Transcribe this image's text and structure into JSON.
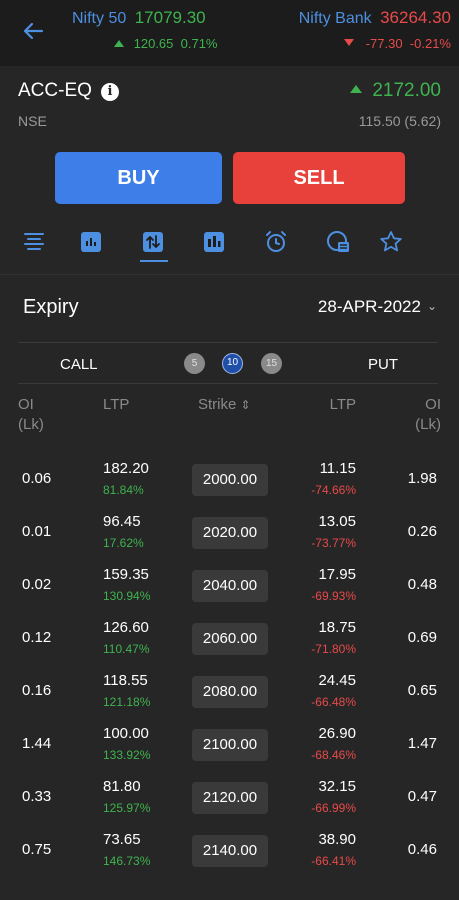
{
  "header": {
    "left_index": {
      "name": "Nifty 50",
      "value": "17079.30",
      "change": "120.65",
      "change_pct": "0.71%"
    },
    "right_index": {
      "name": "Nifty Bank",
      "value": "36264.30",
      "change": "-77.30",
      "change_pct": "-0.21%"
    }
  },
  "instrument": {
    "symbol": "ACC-EQ",
    "exchange": "NSE",
    "ltp": "2172.00",
    "change": "115.50 (5.62)"
  },
  "actions": {
    "buy_label": "BUY",
    "sell_label": "SELL"
  },
  "toolbar": {
    "icons": [
      "market-depth-icon",
      "chart-icon",
      "option-chain-icon",
      "bar-chart-icon",
      "alarm-icon",
      "news-icon",
      "star-icon"
    ]
  },
  "expiry": {
    "label": "Expiry",
    "value": "28-APR-2022"
  },
  "chain": {
    "call_label": "CALL",
    "put_label": "PUT",
    "strike_counts": [
      "5",
      "10",
      "15"
    ],
    "headers": {
      "call_oi": "OI",
      "call_oi_unit": "(Lk)",
      "call_ltp": "LTP",
      "strike": "Strike",
      "put_ltp": "LTP",
      "put_oi": "OI",
      "put_oi_unit": "(Lk)"
    },
    "rows": [
      {
        "call_oi": "0.06",
        "call_ltp": "182.20",
        "call_pct": "81.84%",
        "strike": "2000.00",
        "put_ltp": "11.15",
        "put_pct": "-74.66%",
        "put_oi": "1.98"
      },
      {
        "call_oi": "0.01",
        "call_ltp": "96.45",
        "call_pct": "17.62%",
        "strike": "2020.00",
        "put_ltp": "13.05",
        "put_pct": "-73.77%",
        "put_oi": "0.26"
      },
      {
        "call_oi": "0.02",
        "call_ltp": "159.35",
        "call_pct": "130.94%",
        "strike": "2040.00",
        "put_ltp": "17.95",
        "put_pct": "-69.93%",
        "put_oi": "0.48"
      },
      {
        "call_oi": "0.12",
        "call_ltp": "126.60",
        "call_pct": "110.47%",
        "strike": "2060.00",
        "put_ltp": "18.75",
        "put_pct": "-71.80%",
        "put_oi": "0.69"
      },
      {
        "call_oi": "0.16",
        "call_ltp": "118.55",
        "call_pct": "121.18%",
        "strike": "2080.00",
        "put_ltp": "24.45",
        "put_pct": "-66.48%",
        "put_oi": "0.65"
      },
      {
        "call_oi": "1.44",
        "call_ltp": "100.00",
        "call_pct": "133.92%",
        "strike": "2100.00",
        "put_ltp": "26.90",
        "put_pct": "-68.46%",
        "put_oi": "1.47"
      },
      {
        "call_oi": "0.33",
        "call_ltp": "81.80",
        "call_pct": "125.97%",
        "strike": "2120.00",
        "put_ltp": "32.15",
        "put_pct": "-66.99%",
        "put_oi": "0.47"
      },
      {
        "call_oi": "0.75",
        "call_ltp": "73.65",
        "call_pct": "146.73%",
        "strike": "2140.00",
        "put_ltp": "38.90",
        "put_pct": "-66.41%",
        "put_oi": "0.46"
      }
    ]
  },
  "colors": {
    "up": "#3fb34f",
    "down": "#e84a4a",
    "accent": "#4d8fe0",
    "buy": "#3d7ee8",
    "sell": "#e8403a"
  }
}
